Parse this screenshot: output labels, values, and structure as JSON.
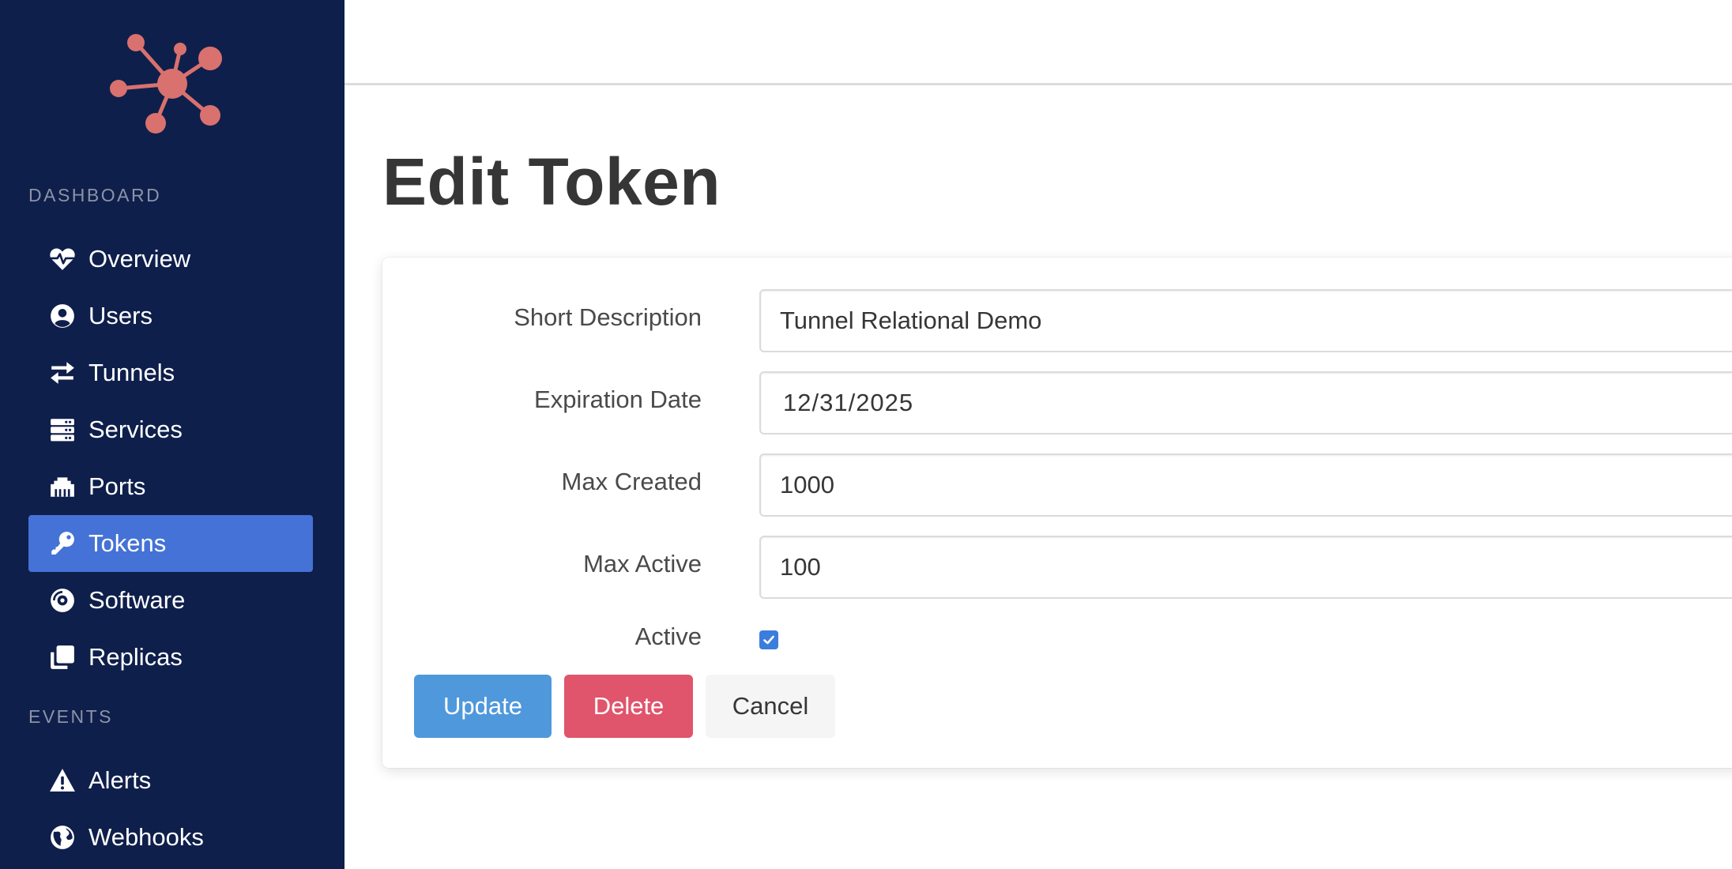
{
  "sidebar": {
    "sections": [
      {
        "label": "DASHBOARD",
        "items": [
          {
            "label": "Overview",
            "icon": "heartbeat-icon"
          },
          {
            "label": "Users",
            "icon": "user-circle-icon"
          },
          {
            "label": "Tunnels",
            "icon": "exchange-arrows-icon"
          },
          {
            "label": "Services",
            "icon": "server-icon"
          },
          {
            "label": "Ports",
            "icon": "ethernet-icon"
          },
          {
            "label": "Tokens",
            "icon": "key-icon",
            "active": true
          },
          {
            "label": "Software",
            "icon": "compact-disc-icon"
          },
          {
            "label": "Replicas",
            "icon": "clone-icon"
          }
        ]
      },
      {
        "label": "EVENTS",
        "items": [
          {
            "label": "Alerts",
            "icon": "warning-triangle-icon"
          },
          {
            "label": "Webhooks",
            "icon": "globe-icon"
          }
        ]
      }
    ]
  },
  "page": {
    "title": "Edit Token"
  },
  "form": {
    "short_description": {
      "label": "Short Description",
      "value": "Tunnel Relational Demo"
    },
    "expiration_date": {
      "label": "Expiration Date",
      "value": "12/31/2025"
    },
    "max_created": {
      "label": "Max Created",
      "value": "1000"
    },
    "max_active": {
      "label": "Max Active",
      "value": "100"
    },
    "active": {
      "label": "Active",
      "checked": true
    }
  },
  "buttons": {
    "update": "Update",
    "delete": "Delete",
    "cancel": "Cancel"
  },
  "colors": {
    "sidebar_bg": "#0f1f4b",
    "active_item": "#4472d6",
    "logo": "#d9716f",
    "update": "#4f98dc",
    "delete": "#e0546c",
    "cancel": "#f5f5f5",
    "checkbox": "#3b7ddd"
  }
}
